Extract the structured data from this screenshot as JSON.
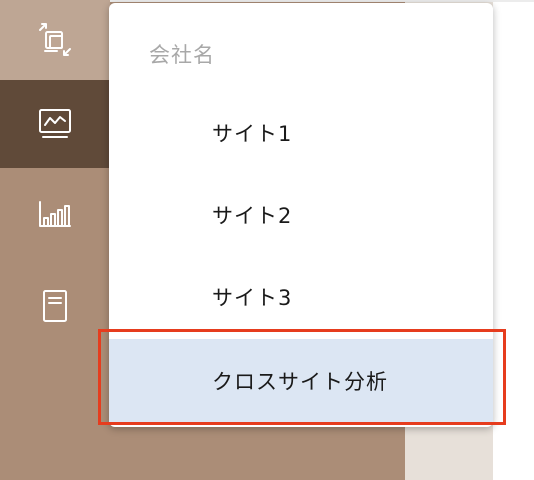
{
  "sidebar": {
    "items": [
      {
        "icon": "switch-app-icon"
      },
      {
        "icon": "monitor-chart-icon",
        "active": true
      },
      {
        "icon": "bar-chart-icon"
      },
      {
        "icon": "document-icon"
      }
    ]
  },
  "menu": {
    "header": "会社名",
    "items": [
      {
        "label": "サイト1"
      },
      {
        "label": "サイト2"
      },
      {
        "label": "サイト3"
      },
      {
        "label": "クロスサイト分析",
        "highlighted": true
      }
    ]
  },
  "colors": {
    "sidebar_bg": "#ab8d77",
    "sidebar_active": "#604a39",
    "sidebar_top": "#bea694",
    "menu_highlight": "#dce6f3",
    "annotation_border": "#e63c1e"
  }
}
